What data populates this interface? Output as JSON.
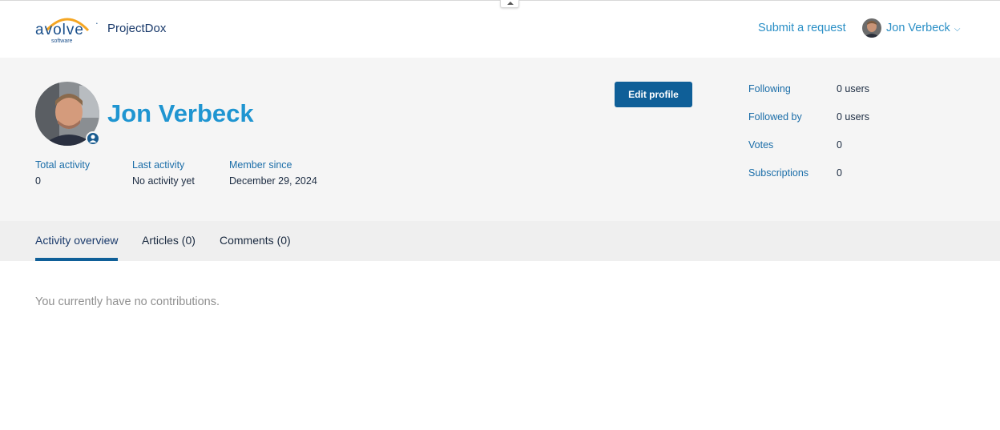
{
  "header": {
    "logo_wordmark": "avolve",
    "logo_subtext": "software",
    "brand_name": "ProjectDox",
    "submit_request": "Submit a request",
    "user_name": "Jon Verbeck",
    "user_menu_chevron": "⌵"
  },
  "profile": {
    "name": "Jon Verbeck",
    "edit_button": "Edit profile",
    "stats": [
      {
        "label": "Total activity",
        "value": "0"
      },
      {
        "label": "Last activity",
        "value": "No activity yet"
      },
      {
        "label": "Member since",
        "value": "December 29, 2024"
      }
    ],
    "side_stats": [
      {
        "label": "Following",
        "value": "0 users"
      },
      {
        "label": "Followed by",
        "value": "0 users"
      },
      {
        "label": "Votes",
        "value": "0"
      },
      {
        "label": "Subscriptions",
        "value": "0"
      }
    ]
  },
  "tabs": [
    {
      "label": "Activity overview",
      "active": true
    },
    {
      "label": "Articles (0)",
      "active": false
    },
    {
      "label": "Comments (0)",
      "active": false
    }
  ],
  "content": {
    "empty_message": "You currently have no contributions."
  },
  "colors": {
    "accent": "#1f95d1",
    "primary_button": "#0f5f98",
    "logo_orange": "#f5a623",
    "logo_blue": "#1a4f8b"
  },
  "icons": {
    "collapse": "chevron-up-icon",
    "badge": "user-badge-icon"
  }
}
